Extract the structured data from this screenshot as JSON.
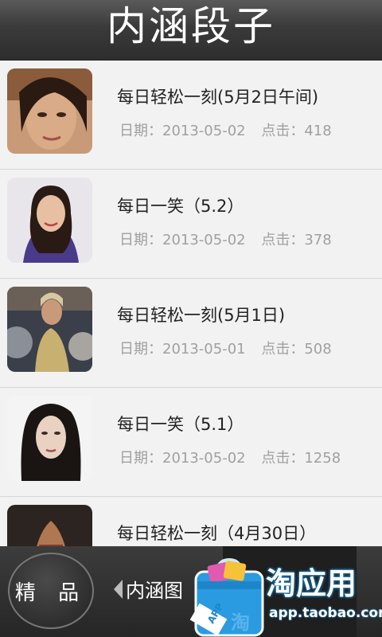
{
  "header": {
    "title": "内涵段子"
  },
  "list": {
    "items": [
      {
        "title": "每日轻松一刻(5月2日午间)",
        "date_label": "日期：2013-05-02",
        "clicks_label": "点击：418",
        "thumb": "portrait-photo"
      },
      {
        "title": "每日一笑（5.2）",
        "date_label": "日期：2013-05-02",
        "clicks_label": "点击：378",
        "thumb": "portrait-photo"
      },
      {
        "title": "每日轻松一刻(5月1日)",
        "date_label": "日期：2013-05-01",
        "clicks_label": "点击：508",
        "thumb": "portrait-photo"
      },
      {
        "title": "每日一笑（5.1）",
        "date_label": "日期：2013-05-02",
        "clicks_label": "点击：1258",
        "thumb": "portrait-photo"
      },
      {
        "title": "每日轻松一刻（4月30日）",
        "date_label": "",
        "clicks_label": "",
        "thumb": "portrait-photo"
      }
    ]
  },
  "bottom_bar": {
    "featured_button": "精 品",
    "tab_label": "内涵图"
  },
  "watermark": {
    "title": "淘应用",
    "url": "app.taobao.com",
    "bag_label": "APP",
    "bag_char": "淘"
  },
  "colors": {
    "header_bg": "#3a3a3a",
    "list_bg": "#f2f2f2",
    "meta_text": "#a0a0a0",
    "watermark_blue": "#1b6fa6"
  }
}
